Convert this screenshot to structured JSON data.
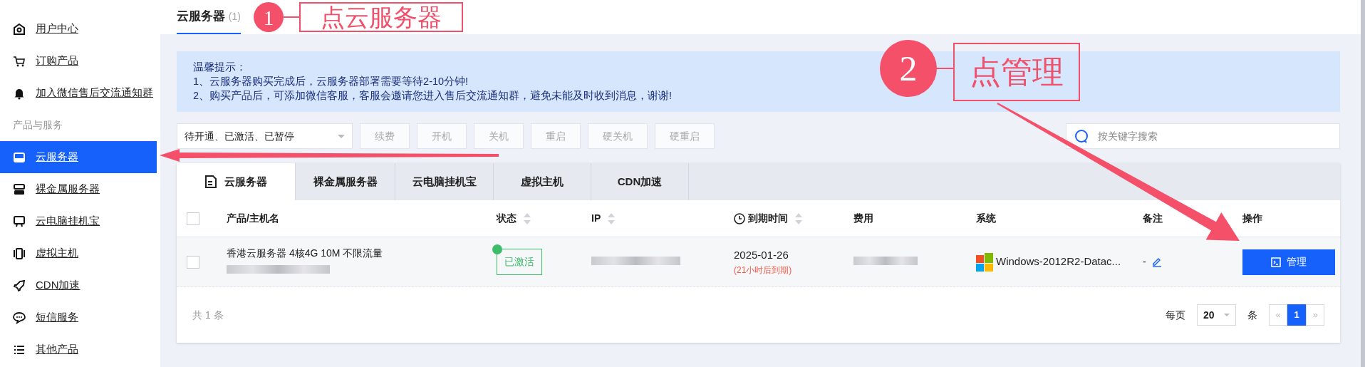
{
  "sidebar": {
    "items": [
      {
        "kind": "item",
        "label": "用户中心",
        "selected": false
      },
      {
        "kind": "item",
        "label": "订购产品",
        "selected": false
      },
      {
        "kind": "item",
        "label": "加入微信售后交流通知群",
        "selected": false
      },
      {
        "kind": "section",
        "label": "产品与服务"
      },
      {
        "kind": "item",
        "label": "云服务器",
        "selected": true
      },
      {
        "kind": "item",
        "label": "裸金属服务器",
        "selected": false
      },
      {
        "kind": "item",
        "label": "云电脑挂机宝",
        "selected": false
      },
      {
        "kind": "item",
        "label": "虚拟主机",
        "selected": false
      },
      {
        "kind": "item",
        "label": "CDN加速",
        "selected": false
      },
      {
        "kind": "item",
        "label": "短信服务",
        "selected": false
      },
      {
        "kind": "item",
        "label": "其他产品",
        "selected": false
      }
    ]
  },
  "page_title": {
    "text": "云服务器",
    "count": "(1)"
  },
  "notice": {
    "title": "温馨提示：",
    "lines": [
      "1、云服务器购买完成后，云服务器部署需要等待2-10分钟!",
      "2、购买产品后，可添加微信客服，客服会邀请您进入售后交流通知群，避免未能及时收到消息，谢谢!"
    ]
  },
  "toolbar": {
    "status_filter": "待开通、已激活、已暂停",
    "buttons": [
      {
        "label": "续费",
        "disabled": true
      },
      {
        "label": "开机",
        "disabled": true
      },
      {
        "label": "关机",
        "disabled": true
      },
      {
        "label": "重启",
        "disabled": true
      },
      {
        "label": "硬关机",
        "disabled": true
      },
      {
        "label": "硬重启",
        "disabled": true
      }
    ],
    "search": {
      "placeholder": "按关键字搜索"
    }
  },
  "tabs": [
    {
      "label": "云服务器",
      "selected": true
    },
    {
      "label": "裸金属服务器",
      "selected": false
    },
    {
      "label": "云电脑挂机宝",
      "selected": false
    },
    {
      "label": "虚拟主机",
      "selected": false
    },
    {
      "label": "CDN加速",
      "selected": false
    }
  ],
  "table": {
    "select_all_checked": false,
    "columns": [
      {
        "label": "产品/主机名",
        "sortable": false
      },
      {
        "label": "状态",
        "sortable": true
      },
      {
        "label": "IP",
        "sortable": true
      },
      {
        "label": "到期时间",
        "sortable": true
      },
      {
        "label": "费用",
        "sortable": false
      },
      {
        "label": "系统",
        "sortable": false
      },
      {
        "label": "备注",
        "sortable": false
      },
      {
        "label": "操作",
        "sortable": false
      }
    ],
    "rows": [
      {
        "checked": false,
        "product": "香港云服务器 4核4G 10M 不限流量",
        "status": "已激活",
        "color": "#3dbd6a",
        "expiry": "2025-01-26",
        "expiry_note": "(21小时后到期)",
        "system": "Windows-2012R2-Datac...",
        "remark": "-",
        "action": "管理"
      }
    ]
  },
  "footer": {
    "total": "共 1 条",
    "per_page_label": "每页",
    "per_page": "20",
    "unit": "条",
    "pages": [
      {
        "label": "«",
        "selected": false
      },
      {
        "label": "1",
        "selected": true
      },
      {
        "label": "»",
        "selected": false
      }
    ]
  },
  "annotations": [
    {
      "kind": "callout",
      "text": "点云服务器"
    },
    {
      "kind": "badge",
      "text": "1"
    },
    {
      "kind": "badge",
      "text": "2"
    },
    {
      "kind": "callout",
      "text": "点管理"
    }
  ]
}
